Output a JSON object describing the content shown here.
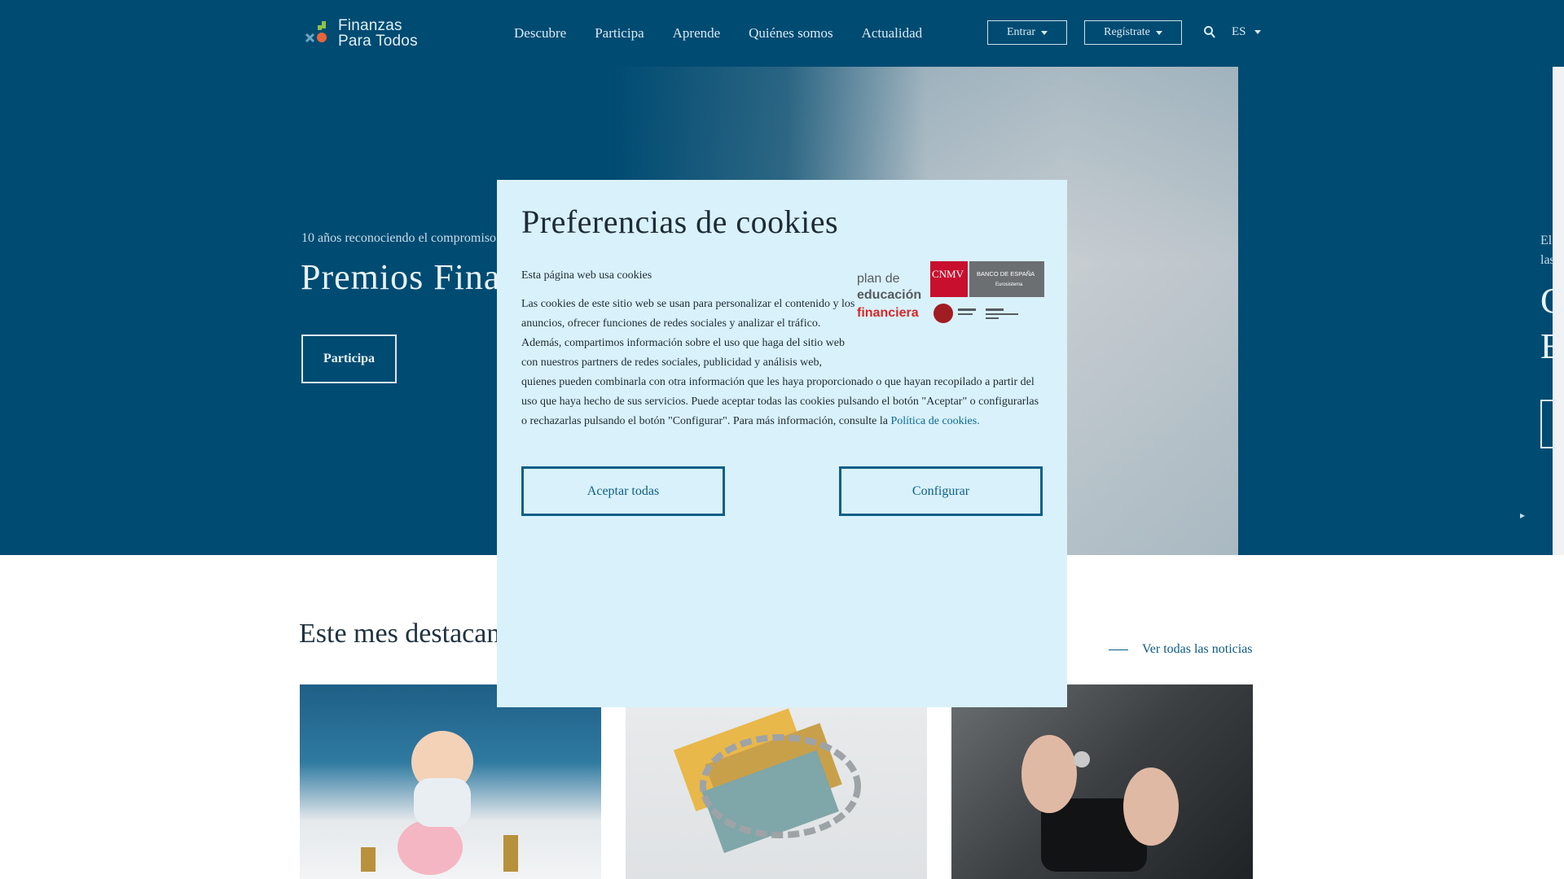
{
  "header": {
    "logo_line1": "Finanzas",
    "logo_line2": "Para Todos",
    "nav": [
      "Descubre",
      "Participa",
      "Aprende",
      "Quiénes somos",
      "Actualidad"
    ],
    "login_label": "Entrar",
    "register_label": "Regístrate",
    "language": "ES"
  },
  "hero": {
    "kicker": "10 años reconociendo el compromiso",
    "title": "Premios Fina",
    "cta_label": "Participa",
    "next_kicker_line1": "El",
    "next_kicker_line2": "las",
    "next_title_line1": "C",
    "next_title_line2": "E"
  },
  "featured": {
    "title": "Este mes destacan",
    "see_all_label": "Ver todas las noticias"
  },
  "cookie_modal": {
    "title": "Preferencias de cookies",
    "subtitle": "Esta página web usa cookies",
    "body": "Las cookies de este sitio web se usan para personalizar el contenido y los anuncios, ofrecer funciones de redes sociales y analizar el tráfico. Además, compartimos información sobre el uso que haga del sitio web con nuestros partners de redes sociales, publicidad y análisis web, quienes pueden combinarla con otra información que les haya proporcionado o que hayan recopilado a partir del uso que haya hecho de sus servicios. Puede aceptar todas las cookies pulsando el botón \"Aceptar\" o configurarlas o rechazarlas pulsando el botón \"Configurar\". Para más información, consulte la",
    "policy_link": "Política de cookies.",
    "accept_label": "Aceptar todas",
    "configure_label": "Configurar",
    "logo": {
      "plan_line1": "plan de",
      "plan_line2": "educación",
      "plan_line3": "financiera",
      "cnmv": "CNMV",
      "bde_line1": "BANCO DE ESPAÑA",
      "bde_line2": "Eurosistema"
    }
  },
  "colors": {
    "primary": "#004b72",
    "modal_bg": "#d9f1fa",
    "button_border": "#0d5f89",
    "cnmv_red": "#c8102e",
    "bde_grey": "#6b6f72",
    "plan_red": "#d62828"
  },
  "icons": {
    "search": "search-icon",
    "caret": "caret-down-icon",
    "arrow": "arrow-right-icon"
  }
}
